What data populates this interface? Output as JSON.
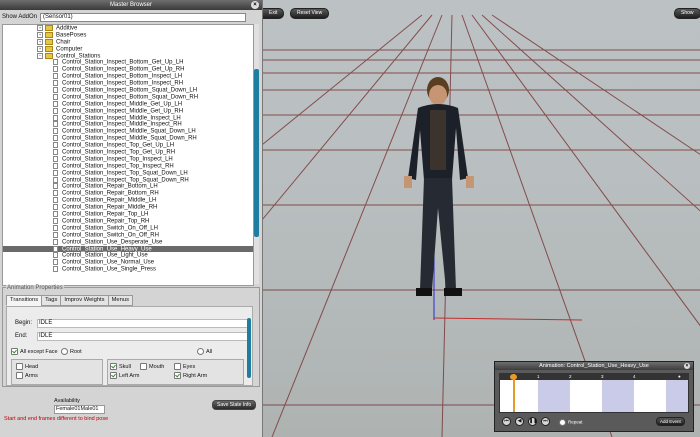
{
  "browser": {
    "title": "Master Browser",
    "show_label": "Show AddOn",
    "show_value": "(Sensor01)",
    "tree": [
      {
        "type": "folder",
        "label": "Additive",
        "indent": 1
      },
      {
        "type": "folder",
        "label": "BasePoses",
        "indent": 1
      },
      {
        "type": "folder",
        "label": "Chair",
        "indent": 1
      },
      {
        "type": "folder",
        "label": "Computer",
        "indent": 1
      },
      {
        "type": "folder",
        "label": "Control_Stations",
        "indent": 1
      },
      {
        "type": "file",
        "label": "Control_Station_Inspect_Bottom_Get_Up_LH"
      },
      {
        "type": "file",
        "label": "Control_Station_Inspect_Bottom_Get_Up_RH"
      },
      {
        "type": "file",
        "label": "Control_Station_Inspect_Bottom_Inspect_LH"
      },
      {
        "type": "file",
        "label": "Control_Station_Inspect_Bottom_Inspect_RH"
      },
      {
        "type": "file",
        "label": "Control_Station_Inspect_Bottom_Squat_Down_LH"
      },
      {
        "type": "file",
        "label": "Control_Station_Inspect_Bottom_Squat_Down_RH"
      },
      {
        "type": "file",
        "label": "Control_Station_Inspect_Middle_Get_Up_LH"
      },
      {
        "type": "file",
        "label": "Control_Station_Inspect_Middle_Get_Up_RH"
      },
      {
        "type": "file",
        "label": "Control_Station_Inspect_Middle_Inspect_LH"
      },
      {
        "type": "file",
        "label": "Control_Station_Inspect_Middle_Inspect_RH"
      },
      {
        "type": "file",
        "label": "Control_Station_Inspect_Middle_Squat_Down_LH"
      },
      {
        "type": "file",
        "label": "Control_Station_Inspect_Middle_Squat_Down_RH"
      },
      {
        "type": "file",
        "label": "Control_Station_Inspect_Top_Get_Up_LH"
      },
      {
        "type": "file",
        "label": "Control_Station_Inspect_Top_Get_Up_RH"
      },
      {
        "type": "file",
        "label": "Control_Station_Inspect_Top_Inspect_LH"
      },
      {
        "type": "file",
        "label": "Control_Station_Inspect_Top_Inspect_RH"
      },
      {
        "type": "file",
        "label": "Control_Station_Inspect_Top_Squat_Down_LH"
      },
      {
        "type": "file",
        "label": "Control_Station_Inspect_Top_Squat_Down_RH"
      },
      {
        "type": "file",
        "label": "Control_Station_Repair_Bottom_LH"
      },
      {
        "type": "file",
        "label": "Control_Station_Repair_Bottom_RH"
      },
      {
        "type": "file",
        "label": "Control_Station_Repair_Middle_LH"
      },
      {
        "type": "file",
        "label": "Control_Station_Repair_Middle_RH"
      },
      {
        "type": "file",
        "label": "Control_Station_Repair_Top_LH"
      },
      {
        "type": "file",
        "label": "Control_Station_Repair_Top_RH"
      },
      {
        "type": "file",
        "label": "Control_Station_Switch_On_Off_LH"
      },
      {
        "type": "file",
        "label": "Control_Station_Switch_On_Off_RH"
      },
      {
        "type": "file",
        "label": "Control_Station_Use_Desperate_Use"
      },
      {
        "type": "file",
        "label": "Control_Station_Use_Heavy_Use",
        "selected": true
      },
      {
        "type": "file",
        "label": "Control_Station_Use_Light_Use"
      },
      {
        "type": "file",
        "label": "Control_Station_Use_Normal_Use"
      },
      {
        "type": "file",
        "label": "Control_Station_Use_Single_Press"
      }
    ]
  },
  "props": {
    "legend": "Animation Properties",
    "tabs": [
      "Transitions",
      "Tags",
      "Improv Weights",
      "Menus"
    ],
    "begin_label": "Begin:",
    "begin_value": "IDLE",
    "end_label": "End:",
    "end_value": "IDLE",
    "all_except_face": "All except Face",
    "root": "Root",
    "all": "All",
    "left_opts": [
      "Head",
      "Arms"
    ],
    "right_opts": [
      "Skull",
      "Mouth",
      "Eyes",
      "Left Arm",
      "Right Arm"
    ]
  },
  "availability": {
    "label": "Availability",
    "value": "Female01Male01"
  },
  "save_button": "Save State Info",
  "warning": "Start and end frames different to bind pose",
  "viewport_buttons": [
    "Exit",
    "Reset View",
    "Show"
  ],
  "anim_panel": {
    "title": "Animation: Control_Station_Use_Heavy_Use",
    "ruler_ticks": [
      "1",
      "2",
      "3",
      "4"
    ],
    "repeat_label": "Repeat",
    "add_event": "Add Event"
  }
}
